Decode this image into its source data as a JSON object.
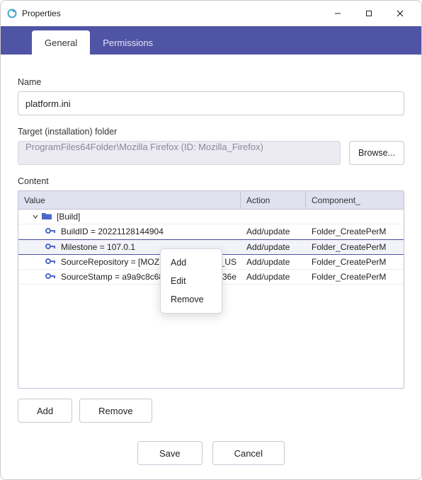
{
  "window": {
    "title": "Properties"
  },
  "tabs": {
    "general": "General",
    "permissions": "Permissions",
    "active": "general"
  },
  "labels": {
    "name": "Name",
    "target": "Target (installation) folder",
    "content": "Content"
  },
  "fields": {
    "name_value": "platform.ini",
    "target_value": "ProgramFiles64Folder\\Mozilla Firefox  (ID: Mozilla_Firefox)"
  },
  "buttons": {
    "browse": "Browse...",
    "add": "Add",
    "remove": "Remove",
    "save": "Save",
    "cancel": "Cancel"
  },
  "content_table": {
    "headers": {
      "value": "Value",
      "action": "Action",
      "component": "Component_"
    },
    "group": {
      "label": "[Build]",
      "expanded": true
    },
    "rows": [
      {
        "key_value": "BuildID = 20221128144904",
        "action": "Add/update",
        "component": "Folder_CreatePerM",
        "selected": false,
        "visible_overflow": ""
      },
      {
        "key_value": "Milestone = 107.0.1",
        "action": "Add/update",
        "component": "Folder_CreatePerM",
        "selected": true,
        "visible_overflow": ""
      },
      {
        "key_value": "SourceRepository = [MOZIL",
        "action": "Add/update",
        "component": "Folder_CreatePerM",
        "selected": false,
        "visible_overflow": "EN_US"
      },
      {
        "key_value": "SourceStamp = a9a9c8c68b",
        "action": "Add/update",
        "component": "Folder_CreatePerM",
        "selected": false,
        "visible_overflow": "036e"
      }
    ]
  },
  "context_menu": {
    "items": [
      "Add",
      "Edit",
      "Remove"
    ]
  },
  "colors": {
    "accent": "#5054a4"
  }
}
